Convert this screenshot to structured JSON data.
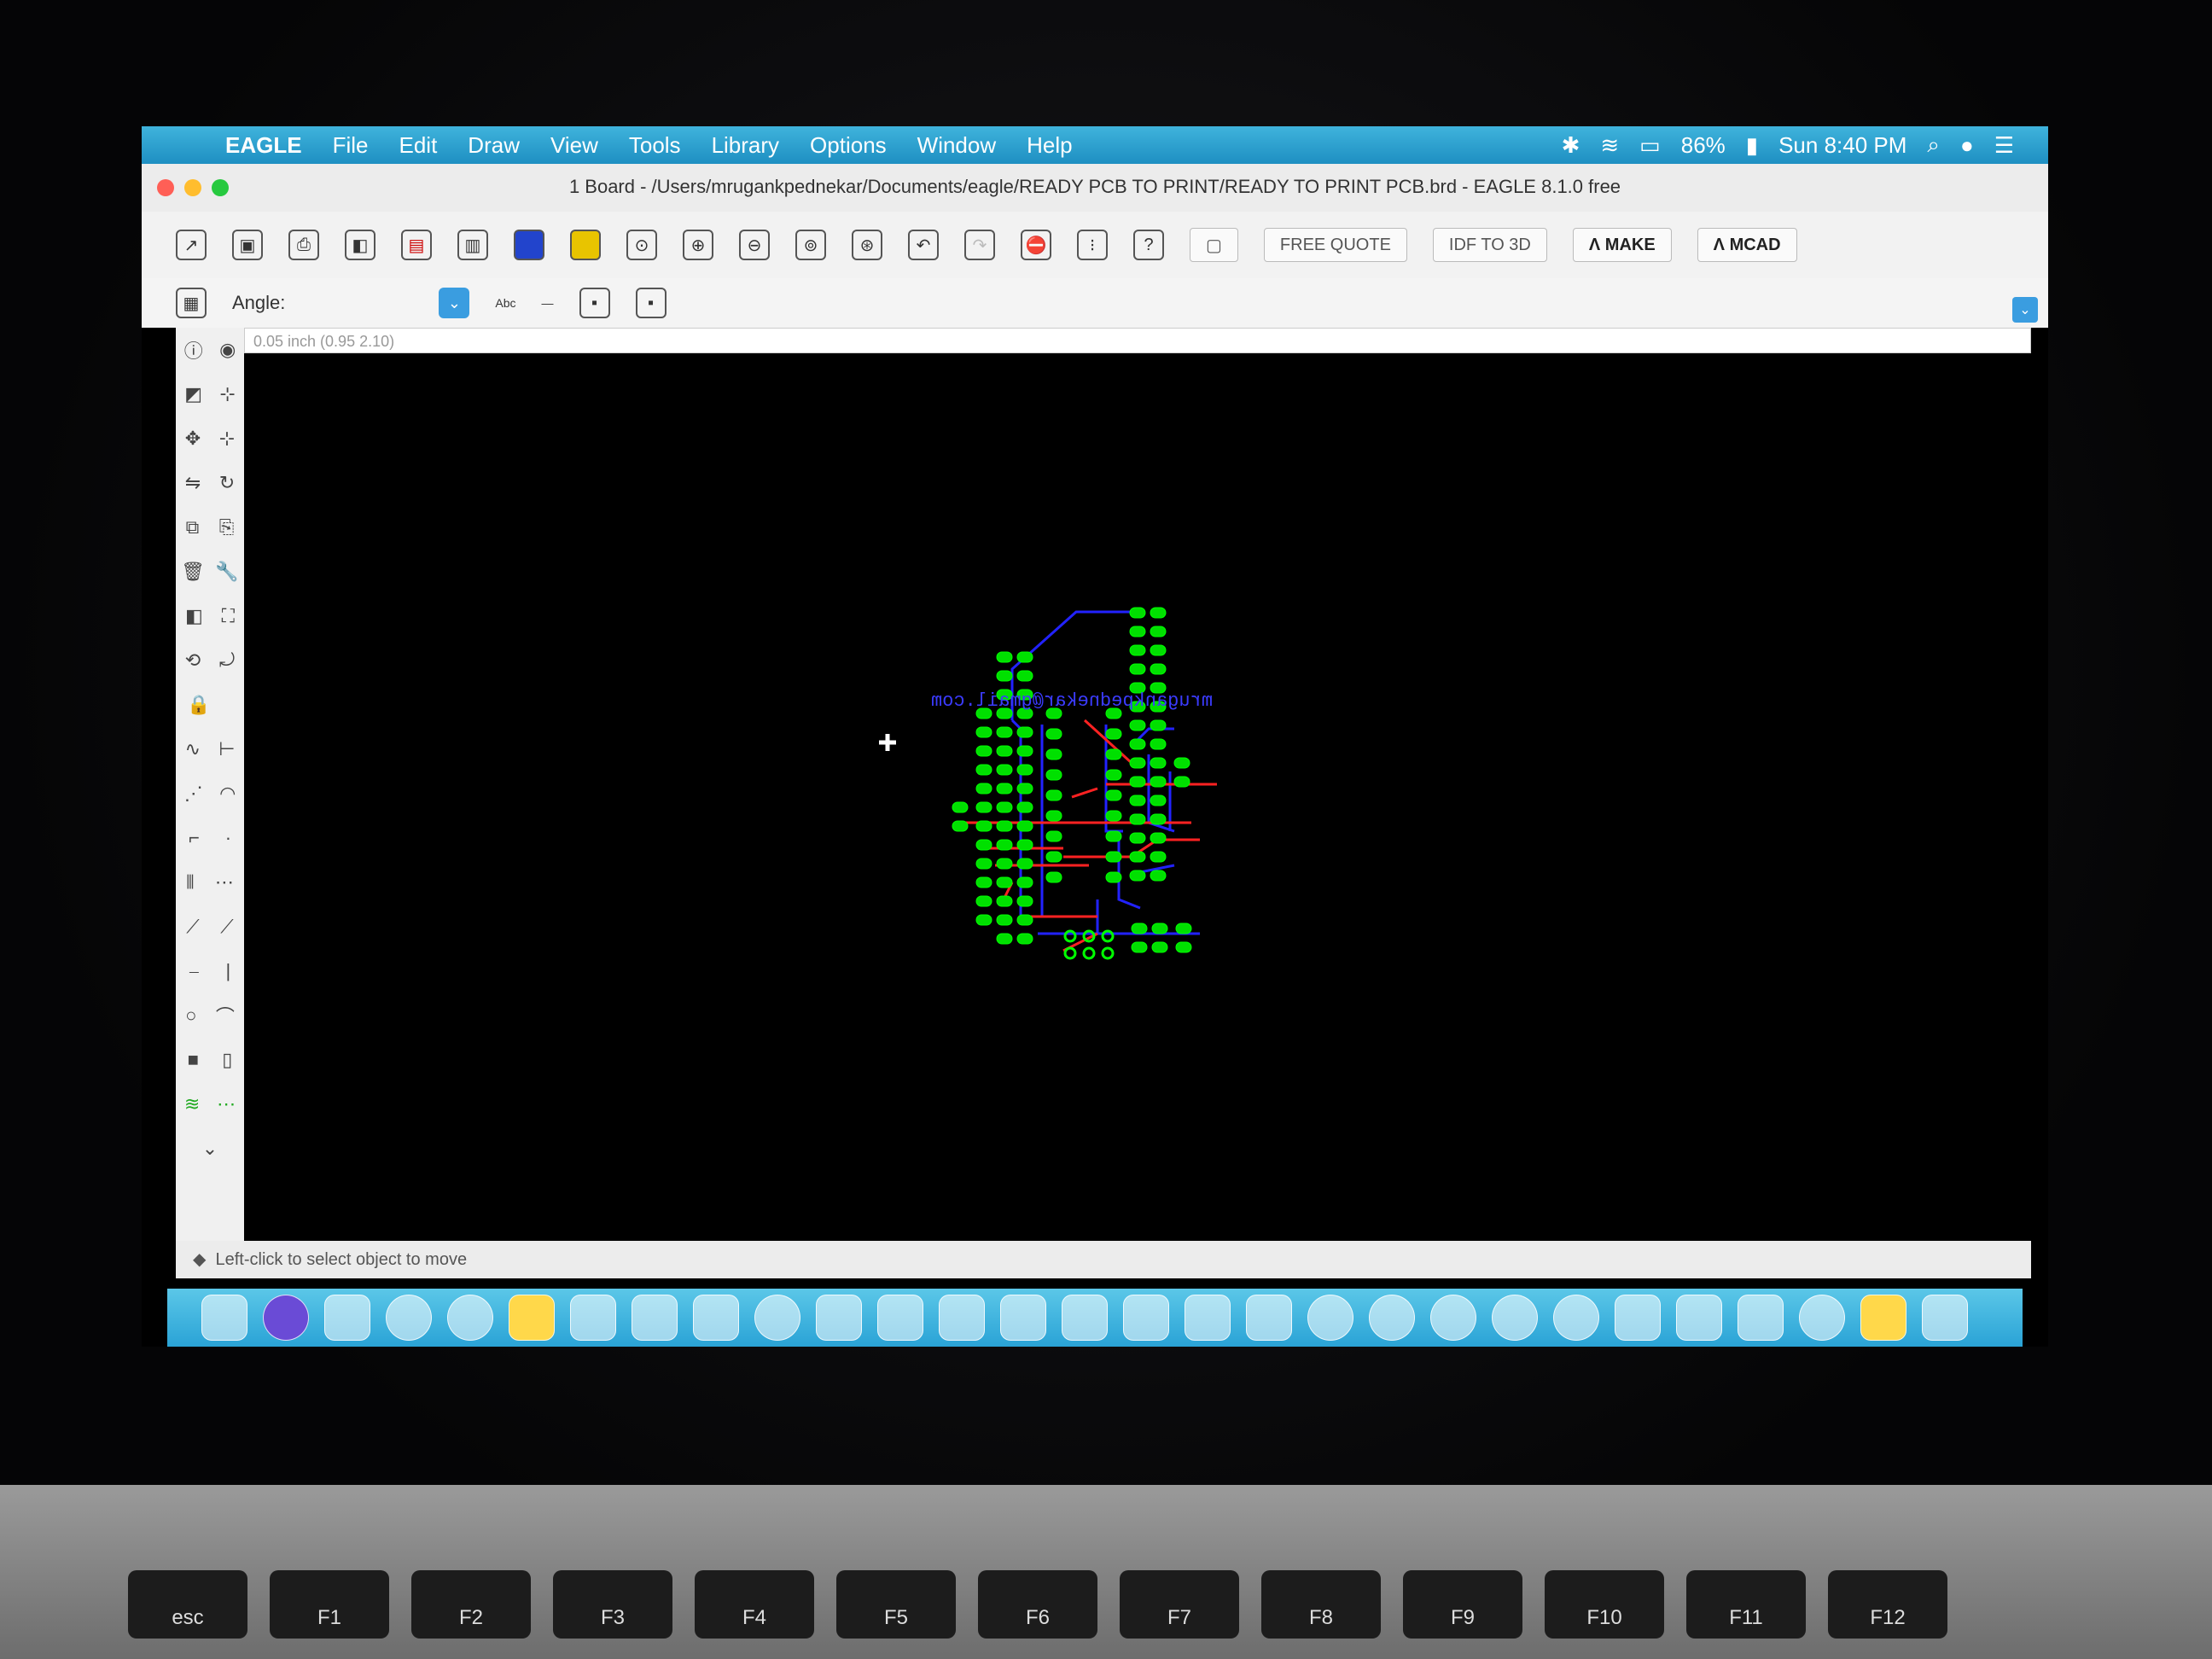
{
  "menubar": {
    "app": "EAGLE",
    "items": [
      "File",
      "Edit",
      "Draw",
      "View",
      "Tools",
      "Library",
      "Options",
      "Window",
      "Help"
    ],
    "battery": "86%",
    "clock": "Sun 8:40 PM"
  },
  "window": {
    "title": "1 Board - /Users/mrugankpednekar/Documents/eagle/READY PCB TO PRINT/READY TO PRINT PCB.brd - EAGLE 8.1.0 free"
  },
  "toolbar": {
    "make_label": "MAKE",
    "mcad_label": "MCAD",
    "quote_label": "FREE QUOTE",
    "idf_label": "IDF TO 3D"
  },
  "params": {
    "angle_label": "Angle:",
    "text_style_label": "Abc"
  },
  "coords": {
    "readout": "0.05 inch (0.95 2.10)"
  },
  "board": {
    "silkscreen_text": "mrugankpednekar@gmail.com"
  },
  "status": {
    "hint": "Left-click to select object to move"
  },
  "keyboard": {
    "keys": [
      "esc",
      "F1",
      "F2",
      "F3",
      "F4",
      "F5",
      "F6",
      "F7",
      "F8",
      "F9",
      "F10",
      "F11",
      "F12"
    ]
  },
  "colors": {
    "menubar": "#2aa3d6",
    "pad": "#00dd00",
    "top_trace": "#ff2020",
    "bottom_trace": "#2020ff",
    "silkscreen": "#3b3bff"
  }
}
